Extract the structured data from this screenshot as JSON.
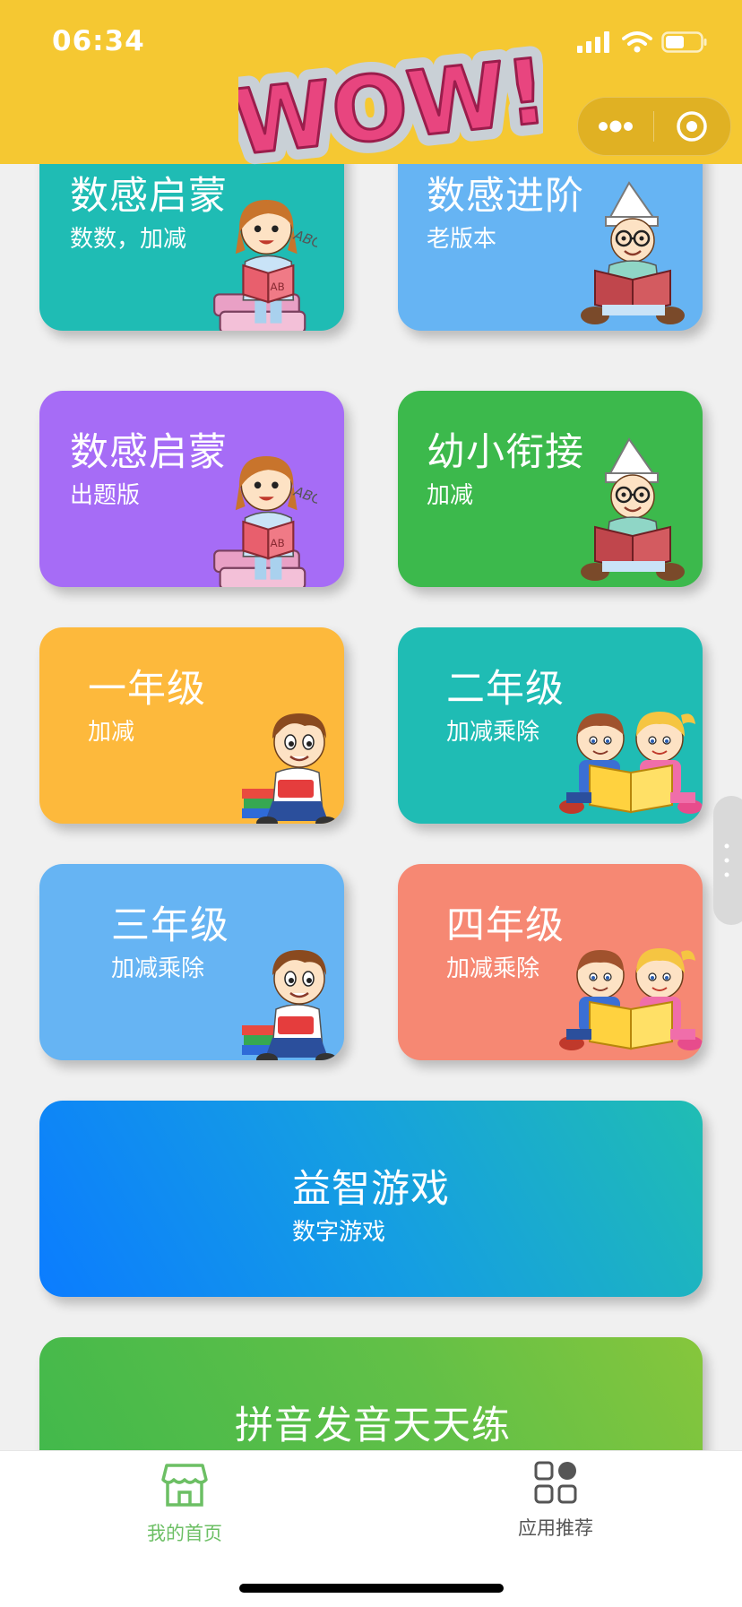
{
  "status_bar": {
    "time": "06:34",
    "icons": [
      "signal-icon",
      "wifi-icon",
      "battery-icon"
    ]
  },
  "header": {
    "logo_text": "WOW!",
    "capsule": [
      "more-icon",
      "close-target-icon"
    ]
  },
  "colors": {
    "header_bg": "#f5c832",
    "page_bg": "#f0f0f0",
    "tab_active": "#6cbf64",
    "tab_inactive": "#555555"
  },
  "cards": [
    {
      "title": "数感启蒙",
      "subtitle": "数数，加减",
      "color": "#1fbcb4",
      "illustration": "girl-reading-icon"
    },
    {
      "title": "数感进阶",
      "subtitle": "老版本",
      "color": "#66b4f3",
      "illustration": "boy-reading-icon"
    },
    {
      "title": "数感启蒙",
      "subtitle": "出题版",
      "color": "#a66cf6",
      "illustration": "girl-reading-icon"
    },
    {
      "title": "幼小衔接",
      "subtitle": "加减",
      "color": "#3cb94c",
      "illustration": "boy-reading-icon"
    },
    {
      "title": "一年级",
      "subtitle": "加减",
      "color": "#fdb93c",
      "illustration": "boy-with-books-icon"
    },
    {
      "title": "二年级",
      "subtitle": "加减乘除",
      "color": "#1fbcb4",
      "illustration": "kids-reading-icon"
    },
    {
      "title": "三年级",
      "subtitle": "加减乘除",
      "color": "#66b4f3",
      "illustration": "boy-with-books-icon"
    },
    {
      "title": "四年级",
      "subtitle": "加减乘除",
      "color": "#f68873",
      "illustration": "kids-reading-icon"
    },
    {
      "title": "益智游戏",
      "subtitle": "数字游戏",
      "color": "#1a8cf0",
      "illustration": ""
    },
    {
      "title": "拼音发音天天练",
      "subtitle": "",
      "color": "#5cbf4a",
      "illustration": ""
    }
  ],
  "tabbar": {
    "items": [
      {
        "label": "我的首页",
        "icon": "home-icon",
        "active": true
      },
      {
        "label": "应用推荐",
        "icon": "grid-apps-icon",
        "active": false
      }
    ]
  }
}
